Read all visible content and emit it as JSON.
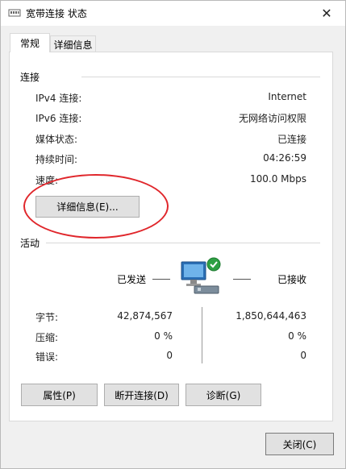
{
  "window": {
    "title": "宽带连接 状态",
    "close_glyph": "✕",
    "title_icon": "network-connection-icon"
  },
  "tabs": [
    {
      "label": "常规",
      "active": true
    },
    {
      "label": "详细信息",
      "active": false
    }
  ],
  "connection": {
    "section_title": "连接",
    "rows": [
      {
        "label": "IPv4 连接:",
        "value": "Internet"
      },
      {
        "label": "IPv6 连接:",
        "value": "无网络访问权限"
      },
      {
        "label": "媒体状态:",
        "value": "已连接"
      },
      {
        "label": "持续时间:",
        "value": "04:26:59"
      },
      {
        "label": "速度:",
        "value": "100.0 Mbps"
      }
    ],
    "details_button": "详细信息(E)...",
    "highlight_color": "#e0262b"
  },
  "activity": {
    "section_title": "活动",
    "sent_label": "已发送",
    "received_label": "已接收",
    "icon": "network-computer-connected-icon",
    "rows": [
      {
        "label": "字节:",
        "sent": "42,874,567",
        "received": "1,850,644,463"
      },
      {
        "label": "压缩:",
        "sent": "0 %",
        "received": "0 %"
      },
      {
        "label": "错误:",
        "sent": "0",
        "received": "0"
      }
    ]
  },
  "buttons": {
    "properties": "属性(P)",
    "disconnect": "断开连接(D)",
    "diagnose": "诊断(G)",
    "close": "关闭(C)"
  }
}
